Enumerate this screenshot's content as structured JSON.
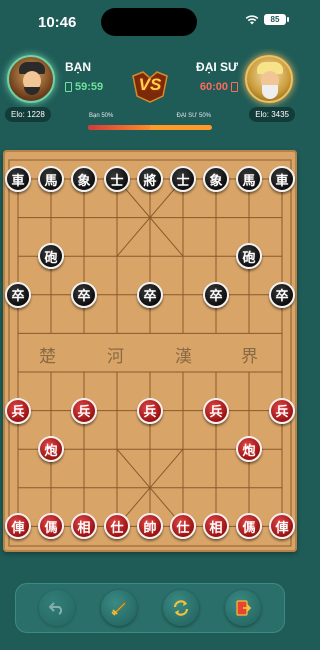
{
  "status_bar": {
    "time": "10:46",
    "battery": "85"
  },
  "players": {
    "me": {
      "name": "BẠN",
      "timer": "59:59",
      "elo": "Elo: 1228",
      "percent_label": "Bạn 50%"
    },
    "opponent": {
      "name": "ĐẠI SƯ",
      "timer": "60:00",
      "elo": "Elo: 3435",
      "percent_label": "ĐẠI SƯ 50%"
    }
  },
  "vs_label": "VS",
  "win_ratio": 0.5,
  "board": {
    "river": [
      "楚",
      "河",
      "漢",
      "界"
    ],
    "pieces": [
      {
        "glyph": "車",
        "color": "black",
        "file": 0,
        "rank": 0
      },
      {
        "glyph": "馬",
        "color": "black",
        "file": 1,
        "rank": 0
      },
      {
        "glyph": "象",
        "color": "black",
        "file": 2,
        "rank": 0
      },
      {
        "glyph": "士",
        "color": "black",
        "file": 3,
        "rank": 0
      },
      {
        "glyph": "將",
        "color": "black",
        "file": 4,
        "rank": 0
      },
      {
        "glyph": "士",
        "color": "black",
        "file": 5,
        "rank": 0
      },
      {
        "glyph": "象",
        "color": "black",
        "file": 6,
        "rank": 0
      },
      {
        "glyph": "馬",
        "color": "black",
        "file": 7,
        "rank": 0
      },
      {
        "glyph": "車",
        "color": "black",
        "file": 8,
        "rank": 0
      },
      {
        "glyph": "砲",
        "color": "black",
        "file": 1,
        "rank": 2
      },
      {
        "glyph": "砲",
        "color": "black",
        "file": 7,
        "rank": 2
      },
      {
        "glyph": "卒",
        "color": "black",
        "file": 0,
        "rank": 3
      },
      {
        "glyph": "卒",
        "color": "black",
        "file": 2,
        "rank": 3
      },
      {
        "glyph": "卒",
        "color": "black",
        "file": 4,
        "rank": 3
      },
      {
        "glyph": "卒",
        "color": "black",
        "file": 6,
        "rank": 3
      },
      {
        "glyph": "卒",
        "color": "black",
        "file": 8,
        "rank": 3
      },
      {
        "glyph": "兵",
        "color": "red",
        "file": 0,
        "rank": 6
      },
      {
        "glyph": "兵",
        "color": "red",
        "file": 2,
        "rank": 6
      },
      {
        "glyph": "兵",
        "color": "red",
        "file": 4,
        "rank": 6
      },
      {
        "glyph": "兵",
        "color": "red",
        "file": 6,
        "rank": 6
      },
      {
        "glyph": "兵",
        "color": "red",
        "file": 8,
        "rank": 6
      },
      {
        "glyph": "炮",
        "color": "red",
        "file": 1,
        "rank": 7
      },
      {
        "glyph": "炮",
        "color": "red",
        "file": 7,
        "rank": 7
      },
      {
        "glyph": "俥",
        "color": "red",
        "file": 0,
        "rank": 9
      },
      {
        "glyph": "傌",
        "color": "red",
        "file": 1,
        "rank": 9
      },
      {
        "glyph": "相",
        "color": "red",
        "file": 2,
        "rank": 9
      },
      {
        "glyph": "仕",
        "color": "red",
        "file": 3,
        "rank": 9
      },
      {
        "glyph": "帥",
        "color": "red",
        "file": 4,
        "rank": 9
      },
      {
        "glyph": "仕",
        "color": "red",
        "file": 5,
        "rank": 9
      },
      {
        "glyph": "相",
        "color": "red",
        "file": 6,
        "rank": 9
      },
      {
        "glyph": "傌",
        "color": "red",
        "file": 7,
        "rank": 9
      },
      {
        "glyph": "俥",
        "color": "red",
        "file": 8,
        "rank": 9
      }
    ]
  },
  "toolbar": {
    "buttons": [
      {
        "icon": "undo-icon",
        "enabled": false
      },
      {
        "icon": "hint-sword-icon",
        "enabled": true
      },
      {
        "icon": "flip-board-icon",
        "enabled": true
      },
      {
        "icon": "exit-door-icon",
        "enabled": true
      }
    ]
  },
  "colors": {
    "background": "#1f5b57",
    "board": "#d8a468",
    "red_piece": "#b01c1c",
    "black_piece": "#1a1a1a",
    "my_timer": "#6fe39c",
    "opponent_timer": "#ff6a5a"
  }
}
